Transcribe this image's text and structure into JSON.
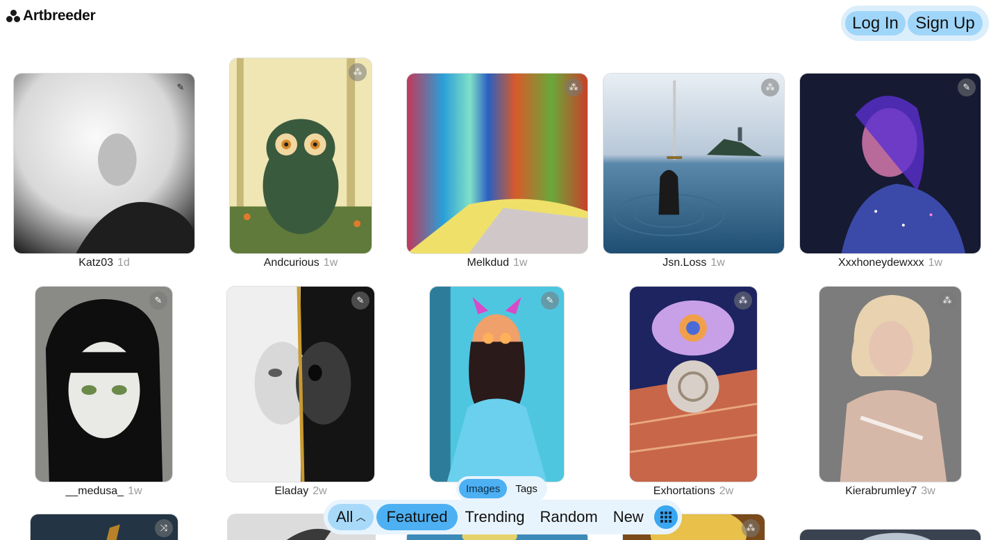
{
  "header": {
    "logo_text": "Artbreeder",
    "login_label": "Log In",
    "signup_label": "Sign Up"
  },
  "cards": [
    {
      "user": "Katz03",
      "age": "1d",
      "badge": "edit-icon",
      "colors": [
        "#f4f4f4",
        "#2a2a2a"
      ]
    },
    {
      "user": "Andcurious",
      "age": "1w",
      "badge": "dna-icon",
      "colors": [
        "#efe9b8",
        "#3d5a3a"
      ]
    },
    {
      "user": "Melkdud",
      "age": "1w",
      "badge": "dna-icon",
      "colors": [
        "#3aa0d0",
        "#e6d83a"
      ]
    },
    {
      "user": "Jsn.Loss",
      "age": "1w",
      "badge": "dna-icon",
      "colors": [
        "#dfe8f2",
        "#2e5f85"
      ]
    },
    {
      "user": "Xxxhoneydewxxx",
      "age": "1w",
      "badge": "edit-icon",
      "colors": [
        "#1a1d3a",
        "#7b4be0"
      ]
    },
    {
      "user": "__medusa_",
      "age": "1w",
      "badge": "edit-icon",
      "colors": [
        "#9a9a9a",
        "#0f0f0f"
      ]
    },
    {
      "user": "Eladay",
      "age": "2w",
      "badge": "edit-icon",
      "colors": [
        "#f2f2f2",
        "#202020"
      ]
    },
    {
      "user": "",
      "age": "",
      "badge": "edit-icon",
      "colors": [
        "#5fd0e8",
        "#1d6d9a"
      ]
    },
    {
      "user": "Exhortations",
      "age": "2w",
      "badge": "dna-icon",
      "colors": [
        "#2a2f7a",
        "#c8664a"
      ]
    },
    {
      "user": "Kierabrumley7",
      "age": "3w",
      "badge": "dna-icon",
      "colors": [
        "#8a8a8a",
        "#d8c2b0"
      ]
    },
    {
      "user": "",
      "age": "",
      "badge": "shuffle-icon",
      "colors": [
        "#233544",
        "#0e1820"
      ]
    },
    {
      "user": "",
      "age": "",
      "badge": "",
      "colors": [
        "#dcdcdc",
        "#3a3a3a"
      ]
    },
    {
      "user": "",
      "age": "",
      "badge": "",
      "colors": [
        "#3c8ab8",
        "#e6d26a"
      ]
    },
    {
      "user": "",
      "age": "",
      "badge": "dna-icon",
      "colors": [
        "#e8c04a",
        "#5a3a10"
      ]
    },
    {
      "user": "",
      "age": "",
      "badge": "dna-icon",
      "colors": [
        "#3a4250",
        "#b8c4d0"
      ]
    }
  ],
  "subtabs": {
    "images_label": "Images",
    "tags_label": "Tags",
    "active": "Images"
  },
  "nav": {
    "all_label": "All",
    "featured_label": "Featured",
    "trending_label": "Trending",
    "random_label": "Random",
    "new_label": "New",
    "active": "Featured"
  },
  "colors": {
    "accent": "#4db0f3",
    "accent_light": "#a8d9f9",
    "nav_bg": "#e8f4fd"
  }
}
